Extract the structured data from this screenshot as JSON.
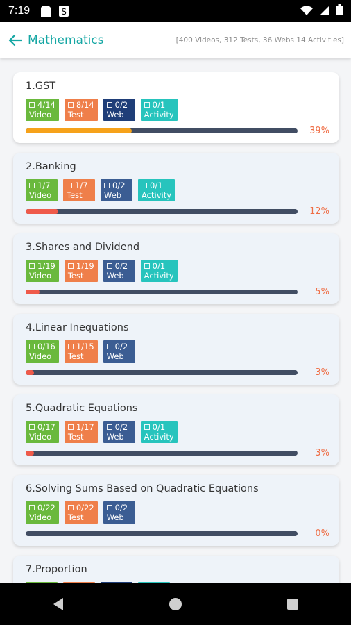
{
  "status_bar": {
    "time": "7:19",
    "icons": [
      "sd-card-icon",
      "sync-icon",
      "wifi-icon",
      "signal-icon",
      "battery-icon"
    ]
  },
  "header": {
    "title": "Mathematics",
    "summary": "[400 Videos, 312 Tests, 36 Webs 14 Activities]"
  },
  "colors": {
    "accent": "#16a7a4",
    "video": "#6ab93d",
    "test": "#ef7f4a",
    "web": "#1f3e78",
    "activity": "#27c4bd",
    "track": "#414d63",
    "percent": "#ef6c43"
  },
  "chapters": [
    {
      "title": "1.GST",
      "chips": [
        {
          "type": "video",
          "count": "4/14",
          "label": "Video"
        },
        {
          "type": "test",
          "count": "8/14",
          "label": "Test"
        },
        {
          "type": "web",
          "count": "0/2",
          "label": "Web"
        },
        {
          "type": "activity",
          "count": "0/1",
          "label": "Activity"
        }
      ],
      "percent": "39%",
      "progress": 39,
      "fill_color": "#f6a21a"
    },
    {
      "title": "2.Banking",
      "chips": [
        {
          "type": "video",
          "count": "1/7",
          "label": "Video"
        },
        {
          "type": "test",
          "count": "1/7",
          "label": "Test"
        },
        {
          "type": "web2",
          "count": "0/2",
          "label": "Web"
        },
        {
          "type": "activity",
          "count": "0/1",
          "label": "Activity"
        }
      ],
      "percent": "12%",
      "progress": 12,
      "fill_color": "#ef5a4a"
    },
    {
      "title": "3.Shares and Dividend",
      "chips": [
        {
          "type": "video",
          "count": "1/19",
          "label": "Video"
        },
        {
          "type": "test",
          "count": "1/19",
          "label": "Test"
        },
        {
          "type": "web2",
          "count": "0/2",
          "label": "Web"
        },
        {
          "type": "activity",
          "count": "0/1",
          "label": "Activity"
        }
      ],
      "percent": "5%",
      "progress": 5,
      "fill_color": "#ef5a4a"
    },
    {
      "title": "4.Linear Inequations",
      "chips": [
        {
          "type": "video",
          "count": "0/16",
          "label": "Video"
        },
        {
          "type": "test",
          "count": "1/15",
          "label": "Test"
        },
        {
          "type": "web2",
          "count": "0/2",
          "label": "Web"
        }
      ],
      "percent": "3%",
      "progress": 3,
      "fill_color": "#ef5a4a"
    },
    {
      "title": "5.Quadratic Equations",
      "chips": [
        {
          "type": "video",
          "count": "0/17",
          "label": "Video"
        },
        {
          "type": "test",
          "count": "1/17",
          "label": "Test"
        },
        {
          "type": "web2",
          "count": "0/2",
          "label": "Web"
        },
        {
          "type": "activity",
          "count": "0/1",
          "label": "Activity"
        }
      ],
      "percent": "3%",
      "progress": 3,
      "fill_color": "#ef5a4a"
    },
    {
      "title": "6.Solving Sums Based on Quadratic Equations",
      "chips": [
        {
          "type": "video",
          "count": "0/22",
          "label": "Video"
        },
        {
          "type": "test",
          "count": "0/22",
          "label": "Test"
        },
        {
          "type": "web2",
          "count": "0/2",
          "label": "Web"
        }
      ],
      "percent": "0%",
      "progress": 0,
      "fill_color": "#ef5a4a"
    },
    {
      "title": "7.Proportion",
      "chips": [
        {
          "type": "video",
          "count": "",
          "label": ""
        },
        {
          "type": "test",
          "count": "",
          "label": ""
        },
        {
          "type": "web",
          "count": "",
          "label": ""
        },
        {
          "type": "activity",
          "count": "",
          "label": ""
        }
      ],
      "percent": "",
      "progress": 0,
      "fill_color": "#ef5a4a"
    }
  ],
  "nav": {
    "back": "nav-back-icon",
    "home": "nav-home-icon",
    "recents": "nav-recents-icon"
  }
}
